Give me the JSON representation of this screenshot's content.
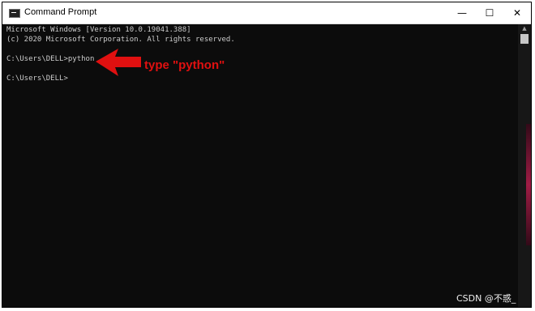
{
  "window": {
    "title": "Command Prompt",
    "icon": "cmd-icon",
    "controls": {
      "minimize": "—",
      "maximize": "☐",
      "close": "✕"
    }
  },
  "console": {
    "lines": [
      "Microsoft Windows [Version 10.0.19041.388]",
      "(c) 2020 Microsoft Corporation. All rights reserved.",
      "",
      "C:\\Users\\DELL>python",
      "",
      "C:\\Users\\DELL>"
    ]
  },
  "annotation": {
    "text": "type \"python\"",
    "color": "#e01010",
    "icon": "red-arrow-icon"
  },
  "watermark": "CSDN @不惑_"
}
